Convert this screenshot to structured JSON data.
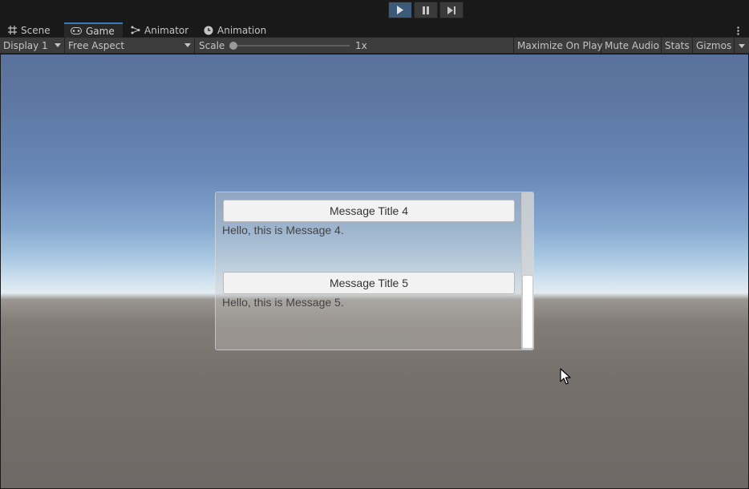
{
  "playbar": {
    "buttons": [
      {
        "name": "play",
        "icon": "play-icon",
        "active": true
      },
      {
        "name": "pause",
        "icon": "pause-icon",
        "active": false
      },
      {
        "name": "step",
        "icon": "step-icon",
        "active": false
      }
    ]
  },
  "tabs": [
    {
      "label": "Scene",
      "icon": "grid-icon",
      "active": false
    },
    {
      "label": "Game",
      "icon": "gamepad-icon",
      "active": true
    },
    {
      "label": "Animator",
      "icon": "animator-icon",
      "active": false
    },
    {
      "label": "Animation",
      "icon": "clock-icon",
      "active": false
    }
  ],
  "toolbar": {
    "display": "Display 1",
    "aspect": "Free Aspect",
    "scale_label": "Scale",
    "scale_value": "1x",
    "maximize_on_play": "Maximize On Play",
    "mute_audio": "Mute Audio",
    "stats": "Stats",
    "gizmos": "Gizmos"
  },
  "messages": [
    {
      "title": "Message Title 4",
      "body": "Hello, this is Message 4."
    },
    {
      "title": "Message Title 5",
      "body": "Hello, this is Message 5."
    }
  ],
  "colors": {
    "accent": "#3a79bb",
    "play_active": "#3b5a7a",
    "toolbar_bg": "#3c3c3c",
    "editor_bg": "#191919"
  }
}
